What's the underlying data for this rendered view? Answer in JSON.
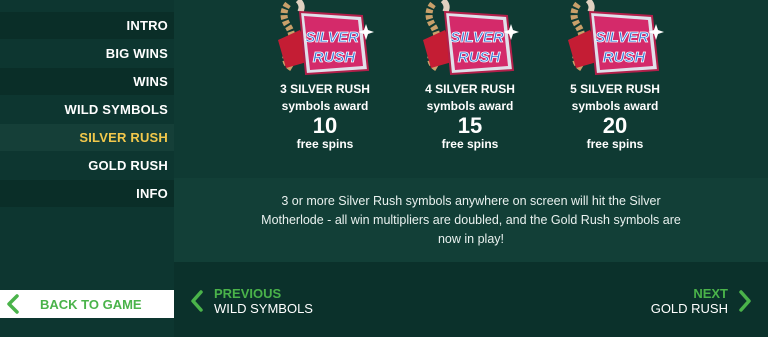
{
  "sidebar": {
    "items": [
      {
        "label": "INTRO"
      },
      {
        "label": "BIG WINS"
      },
      {
        "label": "WINS"
      },
      {
        "label": "WILD SYMBOLS"
      },
      {
        "label": "SILVER RUSH"
      },
      {
        "label": "GOLD RUSH"
      },
      {
        "label": "INFO"
      }
    ],
    "active_index": 4,
    "back_label": "BACK TO GAME"
  },
  "symbols": [
    {
      "logo_text_1": "SILVER",
      "logo_text_2": "RUSH",
      "line1": "3 SILVER RUSH",
      "line2": "symbols award",
      "count": "10",
      "unit": "free spins"
    },
    {
      "logo_text_1": "SILVER",
      "logo_text_2": "RUSH",
      "line1": "4 SILVER RUSH",
      "line2": "symbols award",
      "count": "15",
      "unit": "free spins"
    },
    {
      "logo_text_1": "SILVER",
      "logo_text_2": "RUSH",
      "line1": "5 SILVER RUSH",
      "line2": "symbols award",
      "count": "20",
      "unit": "free spins"
    }
  ],
  "description": "3 or more Silver Rush symbols anywhere on screen will hit the Silver Motherlode - all win multipliers are doubled, and the Gold Rush symbols are now in play!",
  "footer": {
    "prev_small": "PREVIOUS",
    "prev_big": "WILD SYMBOLS",
    "next_small": "NEXT",
    "next_big": "GOLD RUSH"
  },
  "colors": {
    "accent_green": "#4ab34a",
    "active_yellow": "#f2c84b",
    "background": "#0f3a33"
  }
}
